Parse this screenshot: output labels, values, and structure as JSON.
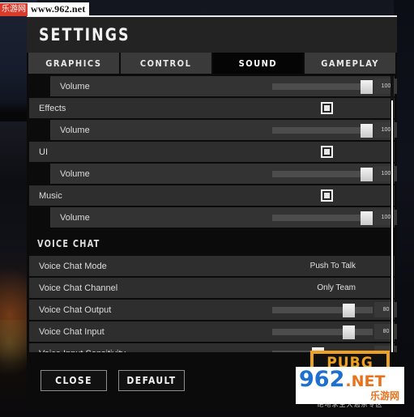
{
  "watermark_top": {
    "badge": "乐游网",
    "url": "www.962.net"
  },
  "dialog": {
    "title": "SETTINGS"
  },
  "tabs": [
    {
      "label": "GRAPHICS",
      "active": false
    },
    {
      "label": "CONTROL",
      "active": false
    },
    {
      "label": "SOUND",
      "active": true
    },
    {
      "label": "GAMEPLAY",
      "active": false
    }
  ],
  "rows": [
    {
      "type": "slider",
      "label": "Volume",
      "value": "100",
      "percent": 100,
      "indent": true
    },
    {
      "type": "checkbox",
      "label": "Effects",
      "checked": true,
      "indent": false
    },
    {
      "type": "slider",
      "label": "Volume",
      "value": "100",
      "percent": 100,
      "indent": true
    },
    {
      "type": "checkbox",
      "label": "UI",
      "checked": true,
      "indent": false
    },
    {
      "type": "slider",
      "label": "Volume",
      "value": "100",
      "percent": 100,
      "indent": true
    },
    {
      "type": "checkbox",
      "label": "Music",
      "checked": true,
      "indent": false
    },
    {
      "type": "slider",
      "label": "Volume",
      "value": "100",
      "percent": 100,
      "indent": true
    },
    {
      "type": "section",
      "label": "VOICE CHAT"
    },
    {
      "type": "value",
      "label": "Voice Chat Mode",
      "value": "Push To Talk"
    },
    {
      "type": "value",
      "label": "Voice Chat Channel",
      "value": "Only Team"
    },
    {
      "type": "slider",
      "label": "Voice Chat Output",
      "value": "80",
      "percent": 80,
      "indent": false
    },
    {
      "type": "slider",
      "label": "Voice Chat Input",
      "value": "80",
      "percent": 80,
      "indent": false
    },
    {
      "type": "slider",
      "label": "Voice Input Sensitivity",
      "value": "45",
      "percent": 45,
      "indent": false
    }
  ],
  "footer": {
    "close_label": "CLOSE",
    "default_label": "DEFAULT"
  },
  "logo": {
    "title": "PUBG",
    "subtitle": "绝地求生大逃杀专区",
    "watermark_num": "962",
    "watermark_net": ".NET",
    "watermark_cn": "乐游网"
  },
  "colors": {
    "accent_orange": "#f0a020",
    "tab_inactive": "#3a3a3a",
    "tab_active": "#050505",
    "row": "#2e2e2e",
    "dialog_bg": "#0b0b0b"
  }
}
